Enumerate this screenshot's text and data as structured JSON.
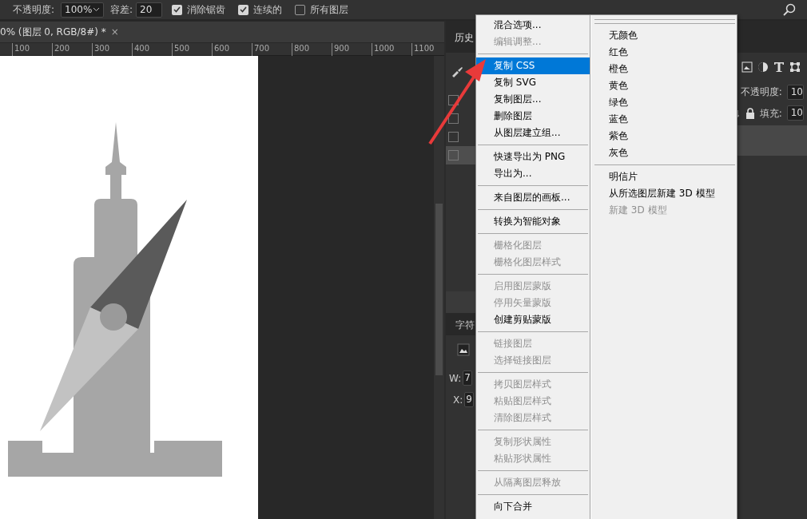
{
  "options_bar": {
    "opacity_label": "不透明度:",
    "opacity_value": "100%",
    "tolerance_label": "容差:",
    "tolerance_value": "20",
    "checkboxes": [
      {
        "label": "消除锯齿",
        "checked": true
      },
      {
        "label": "连续的",
        "checked": true
      },
      {
        "label": "所有图层",
        "checked": false
      }
    ]
  },
  "document_tab": {
    "title": "0% (图层 0, RGB/8#) *",
    "close": "×"
  },
  "ruler": {
    "labels": [
      "100",
      "200",
      "300",
      "400",
      "500",
      "600",
      "700",
      "800",
      "900",
      "1000",
      "1100"
    ]
  },
  "history_panel": {
    "tab": "历史",
    "rows": [
      {
        "checked": false,
        "selected": false
      },
      {
        "checked": false,
        "selected": false
      },
      {
        "checked": false,
        "selected": false
      },
      {
        "checked": false,
        "selected": true
      }
    ]
  },
  "layers_panel": {
    "opacity_label": "不透明度:",
    "opacity_value": "10",
    "fill_label": "填充:",
    "fill_value": "10"
  },
  "character_panel": {
    "tab": "字符",
    "w_label": "W:",
    "w_value": "7",
    "x_label": "X:",
    "x_value": "9"
  },
  "context_menu": {
    "columns": [
      [
        [
          {
            "label": "混合选项...",
            "disabled": false,
            "selected": false
          },
          {
            "label": "编辑调整...",
            "disabled": true,
            "selected": false
          }
        ],
        [
          {
            "label": "复制 CSS",
            "disabled": false,
            "selected": true
          },
          {
            "label": "复制 SVG",
            "disabled": false,
            "selected": false
          },
          {
            "label": "复制图层...",
            "disabled": false,
            "selected": false
          },
          {
            "label": "删除图层",
            "disabled": false,
            "selected": false
          },
          {
            "label": "从图层建立组...",
            "disabled": false,
            "selected": false
          }
        ],
        [
          {
            "label": "快速导出为 PNG",
            "disabled": false,
            "selected": false
          },
          {
            "label": "导出为...",
            "disabled": false,
            "selected": false
          }
        ],
        [
          {
            "label": "来自图层的画板...",
            "disabled": false,
            "selected": false
          }
        ],
        [
          {
            "label": "转换为智能对象",
            "disabled": false,
            "selected": false
          }
        ],
        [
          {
            "label": "栅格化图层",
            "disabled": true,
            "selected": false
          },
          {
            "label": "栅格化图层样式",
            "disabled": true,
            "selected": false
          }
        ],
        [
          {
            "label": "启用图层蒙版",
            "disabled": true,
            "selected": false
          },
          {
            "label": "停用矢量蒙版",
            "disabled": true,
            "selected": false
          },
          {
            "label": "创建剪贴蒙版",
            "disabled": false,
            "selected": false
          }
        ],
        [
          {
            "label": "链接图层",
            "disabled": true,
            "selected": false
          },
          {
            "label": "选择链接图层",
            "disabled": true,
            "selected": false
          }
        ],
        [
          {
            "label": "拷贝图层样式",
            "disabled": true,
            "selected": false
          },
          {
            "label": "粘贴图层样式",
            "disabled": true,
            "selected": false
          },
          {
            "label": "清除图层样式",
            "disabled": true,
            "selected": false
          }
        ],
        [
          {
            "label": "复制形状属性",
            "disabled": true,
            "selected": false
          },
          {
            "label": "粘贴形状属性",
            "disabled": true,
            "selected": false
          }
        ],
        [
          {
            "label": "从隔离图层释放",
            "disabled": true,
            "selected": false
          }
        ],
        [
          {
            "label": "向下合并",
            "disabled": false,
            "selected": false
          }
        ]
      ],
      [
        [],
        [
          {
            "label": "无颜色",
            "disabled": false,
            "selected": false
          },
          {
            "label": "红色",
            "disabled": false,
            "selected": false
          },
          {
            "label": "橙色",
            "disabled": false,
            "selected": false
          },
          {
            "label": "黄色",
            "disabled": false,
            "selected": false
          },
          {
            "label": "绿色",
            "disabled": false,
            "selected": false
          },
          {
            "label": "蓝色",
            "disabled": false,
            "selected": false
          },
          {
            "label": "紫色",
            "disabled": false,
            "selected": false
          },
          {
            "label": "灰色",
            "disabled": false,
            "selected": false
          }
        ],
        [
          {
            "label": "明信片",
            "disabled": false,
            "selected": false
          },
          {
            "label": "从所选图层新建 3D 模型",
            "disabled": false,
            "selected": false
          },
          {
            "label": "新建 3D 模型",
            "disabled": true,
            "selected": false
          }
        ]
      ]
    ]
  }
}
